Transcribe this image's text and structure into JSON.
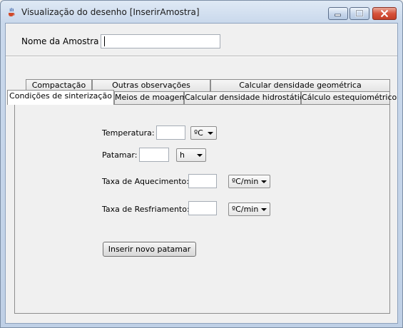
{
  "window": {
    "title": "Visualização do desenho [InserirAmostra]"
  },
  "form": {
    "name_label": "Nome da Amostra",
    "name_value": ""
  },
  "tabs": {
    "row_back": [
      {
        "label": "Compactação"
      },
      {
        "label": "Outras observações"
      },
      {
        "label": "Calcular densidade geométrica"
      }
    ],
    "row_front": [
      {
        "label": "Condições de sinterização",
        "active": true
      },
      {
        "label": "Meios de moagem"
      },
      {
        "label": "Calcular densidade hidrostática"
      },
      {
        "label": "Cálculo estequiométrico"
      }
    ]
  },
  "sinterizacao": {
    "temperatura": {
      "label": "Temperatura:",
      "value": "",
      "unit": "ºC"
    },
    "patamar": {
      "label": "Patamar:",
      "value": "",
      "unit": "h"
    },
    "aquecimento": {
      "label": "Taxa de Aquecimento:",
      "value": "",
      "unit": "ºC/min"
    },
    "resfriamento": {
      "label": "Taxa de Resfriamento:",
      "value": "",
      "unit": "ºC/min"
    },
    "insert_button": "Inserir novo patamar"
  }
}
